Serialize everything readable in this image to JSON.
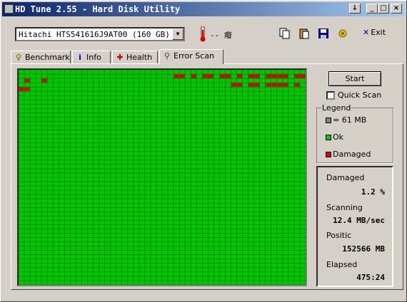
{
  "window": {
    "title": "HD Tune 2.55 - Hard Disk Utility"
  },
  "titlebar_buttons": {
    "menu": "↓",
    "minimize": "_",
    "maximize": "□",
    "close": "×"
  },
  "toolbar": {
    "drive": "Hitachi HTS541616J9AT00 (160 GB)",
    "temperature": "-- 癈",
    "exit_label": "Exit"
  },
  "tabs": [
    {
      "label": "Benchmark",
      "icon": "lightbulb-icon"
    },
    {
      "label": "Info",
      "icon": "info-icon"
    },
    {
      "label": "Health",
      "icon": "health-cross-icon"
    },
    {
      "label": "Error Scan",
      "icon": "magnifier-icon"
    }
  ],
  "controls": {
    "start_label": "Start",
    "quick_scan_label": "Quick Scan",
    "quick_scan_checked": false
  },
  "legend": {
    "title": "Legend",
    "block_size": "= 61 MB",
    "ok": "Ok",
    "damaged": "Damaged"
  },
  "stats": {
    "damaged_label": "Damaged",
    "damaged_value": "1.2 %",
    "scanning_label": "Scanning",
    "scanning_value": "12.4 MB/sec",
    "position_label": "Positic",
    "position_value": "152566 MB",
    "elapsed_label": "Elapsed",
    "elapsed_value": "475:24"
  },
  "colors": {
    "ok": "#00c800",
    "damaged": "#e00000",
    "grid_lines": "#006400",
    "block_legend": "#808080"
  },
  "scan_grid": {
    "columns": 50,
    "rows": 50,
    "damaged_blocks": [
      [
        1,
        27
      ],
      [
        1,
        28
      ],
      [
        1,
        30
      ],
      [
        1,
        32
      ],
      [
        1,
        33
      ],
      [
        1,
        35
      ],
      [
        1,
        36
      ],
      [
        1,
        38
      ],
      [
        1,
        40
      ],
      [
        1,
        41
      ],
      [
        1,
        43
      ],
      [
        1,
        44
      ],
      [
        1,
        45
      ],
      [
        1,
        46
      ],
      [
        1,
        48
      ],
      [
        1,
        49
      ],
      [
        2,
        1
      ],
      [
        2,
        4
      ],
      [
        3,
        37
      ],
      [
        3,
        38
      ],
      [
        3,
        40
      ],
      [
        3,
        41
      ],
      [
        3,
        43
      ],
      [
        3,
        44
      ],
      [
        3,
        45
      ],
      [
        3,
        46
      ],
      [
        3,
        48
      ],
      [
        4,
        0
      ],
      [
        4,
        1
      ]
    ]
  }
}
